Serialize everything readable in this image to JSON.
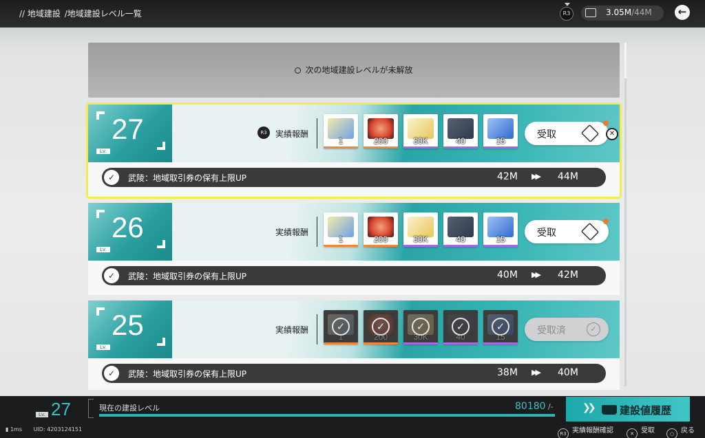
{
  "header": {
    "breadcrumb": [
      "// 地域建設",
      "/地域建設レベル一覧"
    ],
    "r3_label": "R3",
    "currency_current": "3.05M",
    "currency_max": "/44M",
    "back_icon": "arrow-left-icon"
  },
  "locked": {
    "text": "次の地域建設レベルが未解放",
    "icon": "lock-icon"
  },
  "levels": [
    {
      "level": "27",
      "lv_label": "Lv.",
      "r3_label": "R3",
      "reward_label": "実績報酬",
      "items": [
        {
          "qty": "1",
          "color": "#f0883a",
          "art": "#6ea2e8"
        },
        {
          "qty": "200",
          "color": "#f0883a",
          "art": "#d6452e"
        },
        {
          "qty": "30K",
          "color": "#a36be2",
          "art": "#e7c65b"
        },
        {
          "qty": "40",
          "color": "#a36be2",
          "art": "#2f3a4c"
        },
        {
          "qty": "15",
          "color": "#a36be2",
          "art": "#2f6bd3"
        }
      ],
      "claim_label": "受取",
      "claimed": false,
      "effect_text": "武陵：地域取引券の保有上限UP",
      "effect_from": "42M",
      "effect_to": "44M"
    },
    {
      "level": "26",
      "lv_label": "Lv.",
      "reward_label": "実績報酬",
      "items": [
        {
          "qty": "1",
          "color": "#f0883a",
          "art": "#6ea2e8"
        },
        {
          "qty": "200",
          "color": "#f0883a",
          "art": "#d6452e"
        },
        {
          "qty": "30K",
          "color": "#a36be2",
          "art": "#e7c65b"
        },
        {
          "qty": "40",
          "color": "#a36be2",
          "art": "#2f3a4c"
        },
        {
          "qty": "15",
          "color": "#a36be2",
          "art": "#2f6bd3"
        }
      ],
      "claim_label": "受取",
      "claimed": false,
      "effect_text": "武陵：地域取引券の保有上限UP",
      "effect_from": "40M",
      "effect_to": "42M"
    },
    {
      "level": "25",
      "lv_label": "Lv.",
      "reward_label": "実績報酬",
      "items": [
        {
          "qty": "1",
          "color": "#f0883a",
          "art": "#6ea2e8"
        },
        {
          "qty": "200",
          "color": "#f0883a",
          "art": "#d6452e"
        },
        {
          "qty": "30K",
          "color": "#a36be2",
          "art": "#e7c65b"
        },
        {
          "qty": "40",
          "color": "#a36be2",
          "art": "#2f3a4c"
        },
        {
          "qty": "15",
          "color": "#a36be2",
          "art": "#2f6bd3"
        }
      ],
      "claim_label": "受取済",
      "claimed": true,
      "effect_text": "武陵：地域取引券の保有上限UP",
      "effect_from": "38M",
      "effect_to": "40M"
    }
  ],
  "footer": {
    "lv_label": "Lv.",
    "current_level": "27",
    "bar_label": "現在の建設レベル",
    "points": "80180",
    "points_suffix": " /-",
    "progress_fraction": 1.0,
    "history_label": "建設値履歴",
    "ping": "1ms",
    "uid": "UID: 4203124151",
    "hints": [
      {
        "icon": "R3",
        "label": "実績報酬確認"
      },
      {
        "icon": "✕",
        "label": "受取"
      },
      {
        "icon": "○",
        "label": "戻る"
      }
    ]
  },
  "colors": {
    "accent_teal": "#2fb5b6",
    "selected_outline": "#f3ec4a",
    "orange_rarity": "#f0883a",
    "purple_rarity": "#a36be2"
  }
}
